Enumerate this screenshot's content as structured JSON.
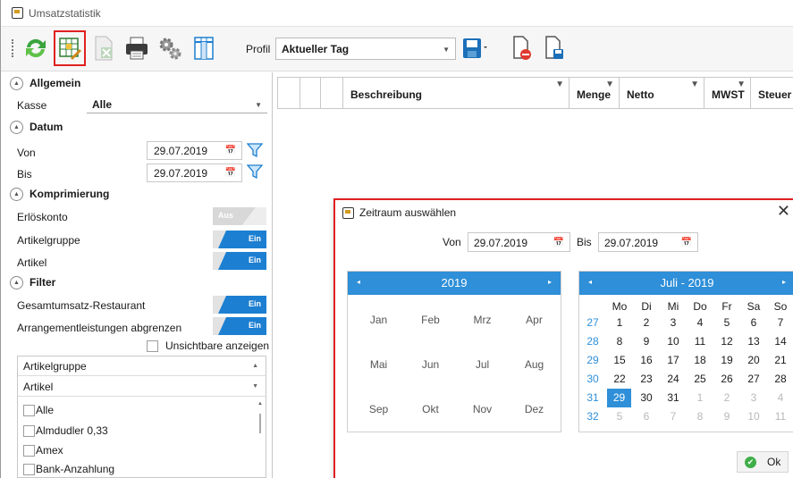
{
  "window": {
    "title": "Umsatzstatistik"
  },
  "toolbar": {
    "profil_label": "Profil",
    "profil_value": "Aktueller Tag",
    "icons": [
      "refresh-icon",
      "grid-settings-icon",
      "excel-export-icon",
      "print-icon",
      "gears-icon",
      "columns-icon",
      "save-icon",
      "delete-profile-icon",
      "save-as-icon"
    ]
  },
  "left": {
    "sections": {
      "allgemein": "Allgemein",
      "datum": "Datum",
      "komprimierung": "Komprimierung",
      "filter": "Filter"
    },
    "kasse_label": "Kasse",
    "kasse_value": "Alle",
    "von_label": "Von",
    "von_value": "29.07.2019",
    "bis_label": "Bis",
    "bis_value": "29.07.2019",
    "erloeskonto": "Erlöskonto",
    "toggle_off": "Aus",
    "artikelgruppe": "Artikelgruppe",
    "artikel": "Artikel",
    "toggle_on": "Ein",
    "gesamtumsatz": "Gesamtumsatz-Restaurant",
    "arrangement": "Arrangementleistungen abgrenzen",
    "unsichtbare": "Unsichtbare anzeigen",
    "filter_headers": [
      "Artikelgruppe",
      "Artikel"
    ],
    "filter_items": [
      "Alle",
      "Almdudler 0,33",
      "Amex",
      "Bank-Anzahlung"
    ]
  },
  "grid": {
    "columns": [
      "Beschreibung",
      "Menge",
      "Netto",
      "MWST",
      "Steuer"
    ]
  },
  "dialog": {
    "title": "Zeitraum auswählen",
    "von_label": "Von",
    "von_value": "29.07.2019",
    "bis_label": "Bis",
    "bis_value": "29.07.2019",
    "year_header": "2019",
    "months": [
      "Jan",
      "Feb",
      "Mrz",
      "Apr",
      "Mai",
      "Jun",
      "Jul",
      "Aug",
      "Sep",
      "Okt",
      "Nov",
      "Dez"
    ],
    "month_header": "Juli - 2019",
    "weekdays": [
      "Mo",
      "Di",
      "Mi",
      "Do",
      "Fr",
      "Sa",
      "So"
    ],
    "weeks": [
      "27",
      "28",
      "29",
      "30",
      "31",
      "32"
    ],
    "days": [
      [
        "1",
        "2",
        "3",
        "4",
        "5",
        "6",
        "7"
      ],
      [
        "8",
        "9",
        "10",
        "11",
        "12",
        "13",
        "14"
      ],
      [
        "15",
        "16",
        "17",
        "18",
        "19",
        "20",
        "21"
      ],
      [
        "22",
        "23",
        "24",
        "25",
        "26",
        "27",
        "28"
      ],
      [
        "29",
        "30",
        "31",
        "1",
        "2",
        "3",
        "4"
      ],
      [
        "5",
        "6",
        "7",
        "8",
        "9",
        "10",
        "11"
      ]
    ],
    "ok": "Ok"
  }
}
